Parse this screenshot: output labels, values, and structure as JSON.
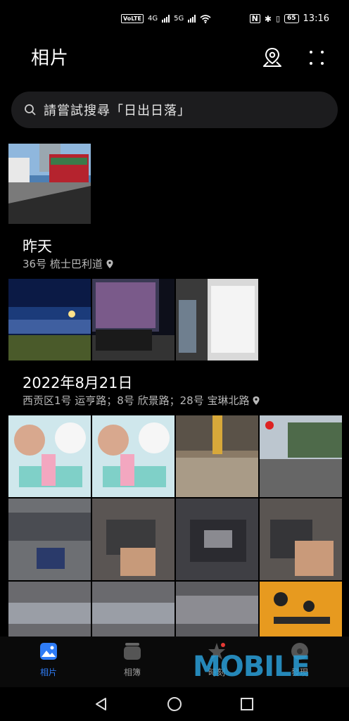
{
  "status": {
    "time": "13:16",
    "battery": "65",
    "volte": "VoLTE",
    "net1": "4G",
    "net2": "5G"
  },
  "header": {
    "title": "相片",
    "map_icon": "location-map-icon",
    "more_icon": "more-dots-icon"
  },
  "search": {
    "placeholder": "請嘗試搜尋「日出日落」"
  },
  "sections": [
    {
      "date": "昨天",
      "location": "36号 梳士巴利道"
    },
    {
      "date": "2022年8月21日",
      "location": "西贡区1号 运亨路；8号 欣景路；28号 宝琳北路"
    }
  ],
  "bottom_nav": [
    {
      "label": "相片",
      "icon": "photos-icon",
      "active": true
    },
    {
      "label": "相簿",
      "icon": "albums-icon",
      "active": false
    },
    {
      "label": "時刻",
      "icon": "moments-icon",
      "active": false
    },
    {
      "label": "發現",
      "icon": "discover-icon",
      "active": false
    }
  ],
  "watermark": "MOBILE",
  "system_nav": [
    "back-icon",
    "home-icon",
    "recents-icon"
  ],
  "colors": {
    "accent": "#2f7cf6",
    "background": "#000000",
    "search_bg": "#1c1c1e"
  }
}
